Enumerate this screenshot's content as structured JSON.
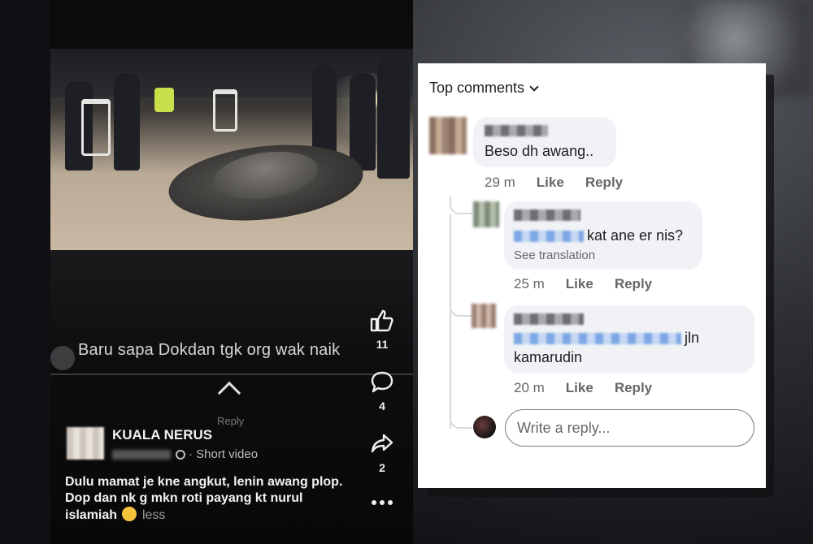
{
  "video": {
    "overlay_caption": "Baru sapa Dokdan tgk org wak naik",
    "reply_hint": "Reply",
    "poster_name": "KUALA NERUS",
    "poster_meta": "· Short video",
    "caption": "Dulu mamat je kne angkut, lenin awang plop. Dop dan nk g mkn roti payang kt nurul islamiah",
    "less_label": "less",
    "actions": [
      {
        "icon": "thumbs-up-icon",
        "count": "11"
      },
      {
        "icon": "comment-icon",
        "count": "4"
      },
      {
        "icon": "share-icon",
        "count": "2"
      },
      {
        "icon": "more-icon",
        "count": ""
      }
    ]
  },
  "comments_panel": {
    "header": "Top comments",
    "comments": [
      {
        "text": "Beso dh awang..",
        "time": "29 m",
        "like": "Like",
        "reply": "Reply"
      }
    ],
    "replies": [
      {
        "text": "kat ane er nis?",
        "translation": "See translation",
        "time": "25 m",
        "like": "Like",
        "reply": "Reply"
      },
      {
        "text_a": "jln",
        "text_b": "kamarudin",
        "time": "20 m",
        "like": "Like",
        "reply": "Reply"
      }
    ],
    "write_reply_placeholder": "Write a reply..."
  },
  "colors": {
    "panel_bg": "#ffffff",
    "bubble_bg": "#f0f2f5",
    "meta_gray": "#65676b",
    "video_bg": "#0b0b0c"
  }
}
